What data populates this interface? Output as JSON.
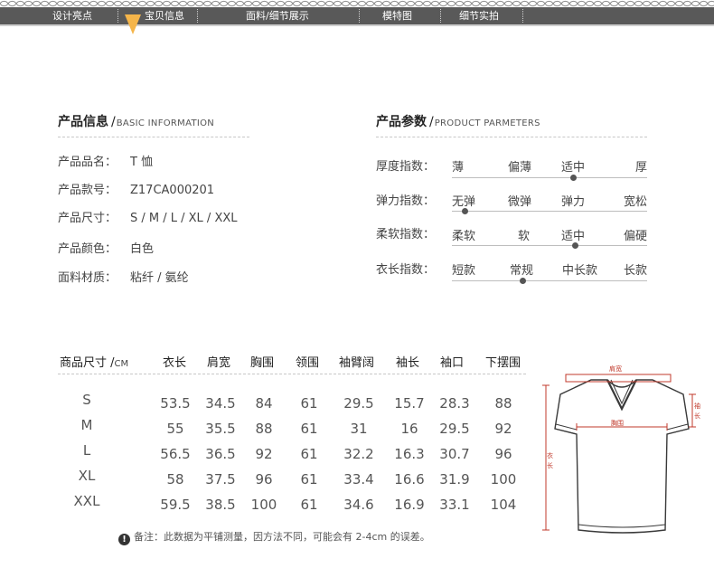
{
  "nav": {
    "tabs": [
      {
        "label": "设计亮点"
      },
      {
        "label": "宝贝信息"
      },
      {
        "label": "面料/细节展示"
      },
      {
        "label": "模特图"
      },
      {
        "label": "细节实拍"
      }
    ],
    "active_index": 1,
    "bar_color": "#595959",
    "pointer_color": "#f5b54a"
  },
  "info": {
    "title": "产品信息",
    "subtitle": "BASIC INFORMATION",
    "rows": [
      {
        "label": "产品品名：",
        "value": "T 恤"
      },
      {
        "label": "产品款号：",
        "value": "Z17CA000201"
      },
      {
        "label": "产品尺寸：",
        "value": "S / M / L / XL / XXL"
      },
      {
        "label": "产品颜色：",
        "value": "白色"
      },
      {
        "label": "面料材质：",
        "value": "粘纤 / 氨纶"
      }
    ]
  },
  "params": {
    "title": "产品参数",
    "subtitle": "PRODUCT PARMETERS",
    "rows": [
      {
        "label": "厚度指数：",
        "options": [
          "薄",
          "偏薄",
          "适中",
          "厚"
        ],
        "selected": 2
      },
      {
        "label": "弹力指数：",
        "options": [
          "无弹",
          "微弹",
          "弹力",
          "宽松"
        ],
        "selected": 0
      },
      {
        "label": "柔软指数：",
        "options": [
          "柔软",
          "软",
          "适中",
          "偏硬"
        ],
        "selected": 2
      },
      {
        "label": "衣长指数：",
        "options": [
          "短款",
          "常规",
          "中长款",
          "长款"
        ],
        "selected": 1
      }
    ]
  },
  "size_table": {
    "header_label": "商品尺寸",
    "header_unit": "CM",
    "columns": [
      "衣长",
      "肩宽",
      "胸围",
      "领围",
      "袖臂阔",
      "袖长",
      "袖口",
      "下摆围"
    ],
    "rows": [
      {
        "size": "S",
        "values": [
          "53.5",
          "34.5",
          "84",
          "61",
          "29.5",
          "15.7",
          "28.3",
          "88"
        ]
      },
      {
        "size": "M",
        "values": [
          "55",
          "35.5",
          "88",
          "61",
          "31",
          "16",
          "29.5",
          "92"
        ]
      },
      {
        "size": "L",
        "values": [
          "56.5",
          "36.5",
          "92",
          "61",
          "32.2",
          "16.3",
          "30.7",
          "96"
        ]
      },
      {
        "size": "XL",
        "values": [
          "58",
          "37.5",
          "96",
          "61",
          "33.4",
          "16.6",
          "31.9",
          "100"
        ]
      },
      {
        "size": "XXL",
        "values": [
          "59.5",
          "38.5",
          "100",
          "61",
          "34.6",
          "16.9",
          "33.1",
          "104"
        ]
      }
    ],
    "note": "备注：此数据为平铺测量，因方法不同，可能会有 2-4cm 的误差。"
  },
  "diagram": {
    "labels": {
      "shoulder": "肩宽",
      "chest": "胸围",
      "sleeve_chars": [
        "袖",
        "长"
      ],
      "length_chars": [
        "衣",
        "长"
      ]
    },
    "measure_color": "#c0392b"
  }
}
